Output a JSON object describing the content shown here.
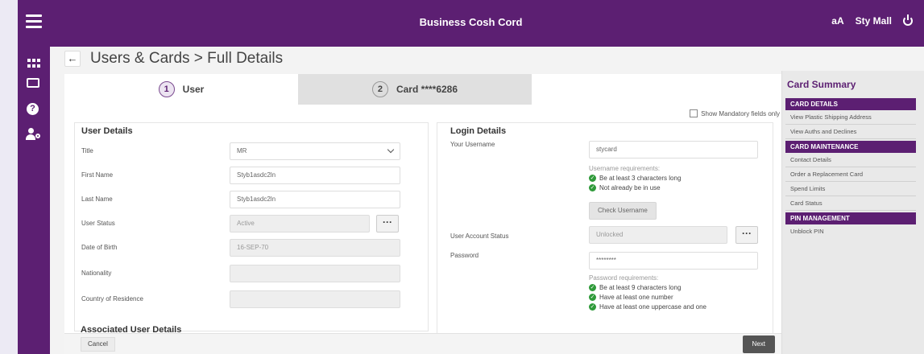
{
  "app": {
    "title": "Business Cosh Cord",
    "font_toggle": "aA",
    "user_name": "Sty Mall"
  },
  "page": {
    "title": "Users & Cards > Full Details",
    "back_icon": "←"
  },
  "tabs": [
    {
      "num": "1",
      "label": "User"
    },
    {
      "num": "2",
      "label": "Card ****6286"
    }
  ],
  "mandatory_label": "Show Mandatory fields only",
  "user_details": {
    "heading": "User Details",
    "title_label": "Title",
    "title_value": "MR",
    "first_name_label": "First Name",
    "first_name_value": "Styb1asdc2ln",
    "last_name_label": "Last Name",
    "last_name_value": "Styb1asdc2ln",
    "status_label": "User Status",
    "status_value": "Active",
    "dots": "···",
    "dob_label": "Date of Birth",
    "dob_value": "16-SEP-70",
    "nationality_label": "Nationality",
    "country_label": "Country of Residence"
  },
  "login_details": {
    "heading": "Login Details",
    "username_label": "Your Username",
    "username_value": "stycard",
    "username_req_title": "Username requirements:",
    "username_reqs": [
      "Be at least 3 characters long",
      "Not already be in use"
    ],
    "check_button": "Check Username",
    "account_status_label": "User Account Status",
    "account_status_value": "Unlocked",
    "password_label": "Password",
    "password_value": "********",
    "password_req_title": "Password requirements:",
    "password_reqs": [
      "Be at least 9 characters long",
      "Have at least one number",
      "Have at least one uppercase and one"
    ]
  },
  "associated_heading": "Associated User Details",
  "footer": {
    "cancel": "Cancel",
    "next": "Next"
  },
  "summary": {
    "title": "Card Summary",
    "sections": [
      {
        "head": "CARD DETAILS",
        "items": [
          "View Plastic Shipping Address",
          "View Auths and Declines"
        ]
      },
      {
        "head": "CARD MAINTENANCE",
        "items": [
          "Contact Details",
          "Order a Replacement Card",
          "Spend Limits",
          "Card Status"
        ]
      },
      {
        "head": "PIN MANAGEMENT",
        "items": [
          "Unblock PIN"
        ]
      }
    ]
  },
  "colors": {
    "brand": "#5c1f72",
    "success": "#2f9a3a"
  }
}
